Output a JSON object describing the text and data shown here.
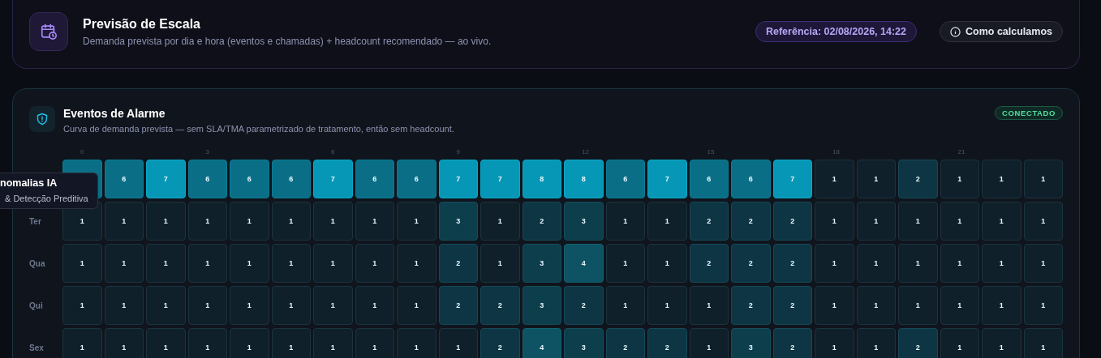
{
  "header": {
    "title": "Previsão de Escala",
    "subtitle": "Demanda prevista por dia e hora (eventos e chamadas) + headcount recomendado — ao vivo.",
    "reference_badge": "Referência: 02/08/2026, 14:22",
    "info_button": "Como calculamos"
  },
  "panel": {
    "title": "Eventos de Alarme",
    "subtitle": "Curva de demanda prevista — sem SLA/TMA parametrizado de tratamento, então sem headcount.",
    "status_badge": "CONECTADO",
    "hour_labels": [
      "0",
      "3",
      "6",
      "9",
      "12",
      "15",
      "18",
      "21"
    ],
    "rows": [
      {
        "cells": [
          "",
          "6",
          "7",
          "6",
          "6",
          "6",
          "7",
          "6",
          "6",
          "7",
          "7",
          "8",
          "8",
          "6",
          "7",
          "6",
          "6",
          "7",
          "1",
          "1",
          "2",
          "1",
          "1",
          "1"
        ]
      },
      {
        "label": "Ter",
        "cells": [
          "1",
          "1",
          "1",
          "1",
          "1",
          "1",
          "1",
          "1",
          "1",
          "3",
          "1",
          "2",
          "3",
          "1",
          "1",
          "2",
          "2",
          "2",
          "1",
          "1",
          "1",
          "1",
          "1",
          "1"
        ]
      },
      {
        "label": "Qua",
        "cells": [
          "1",
          "1",
          "1",
          "1",
          "1",
          "1",
          "1",
          "1",
          "1",
          "2",
          "1",
          "3",
          "4",
          "1",
          "1",
          "2",
          "2",
          "2",
          "1",
          "1",
          "1",
          "1",
          "1",
          "1"
        ]
      },
      {
        "label": "Qui",
        "cells": [
          "1",
          "1",
          "1",
          "1",
          "1",
          "1",
          "1",
          "1",
          "1",
          "2",
          "2",
          "3",
          "2",
          "1",
          "1",
          "1",
          "2",
          "2",
          "1",
          "1",
          "1",
          "1",
          "1",
          "1"
        ]
      },
      {
        "label": "Sex",
        "cells": [
          "1",
          "1",
          "1",
          "1",
          "1",
          "1",
          "1",
          "1",
          "1",
          "1",
          "2",
          "4",
          "3",
          "2",
          "2",
          "1",
          "3",
          "2",
          "1",
          "1",
          "2",
          "1",
          "1",
          "1"
        ]
      }
    ]
  },
  "tooltip": {
    "title": "nomalias IA",
    "subtitle": "& Detecção Preditiva"
  }
}
